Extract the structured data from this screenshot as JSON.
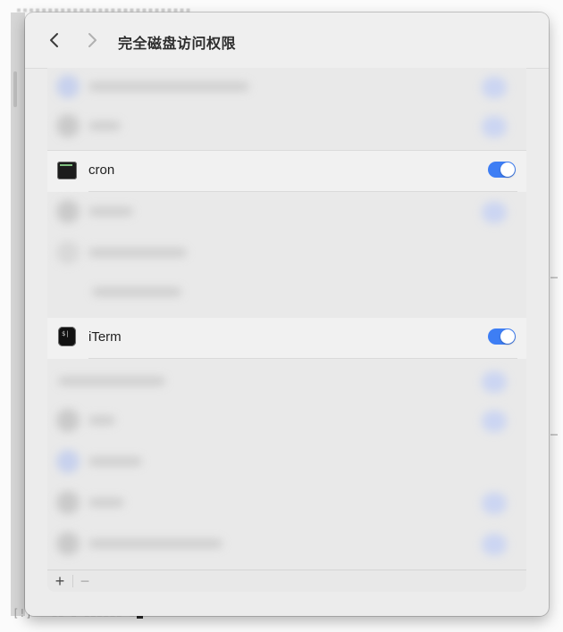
{
  "window": {
    "title": "完全磁盘访问权限"
  },
  "icons": {
    "back": "chevron-left-icon",
    "forward": "chevron-right-icon",
    "cron": "terminal-app-icon",
    "iterm": "iterm-app-icon"
  },
  "apps": [
    {
      "name": "cron",
      "enabled": true
    },
    {
      "name": "iTerm",
      "enabled": true
    }
  ],
  "bottom_bar": {
    "add_label": "+",
    "remove_label": "−"
  },
  "colors": {
    "toggle_on": "#3e7ef4",
    "window_bg": "#ececec",
    "list_bg": "#e9e9e9"
  }
}
